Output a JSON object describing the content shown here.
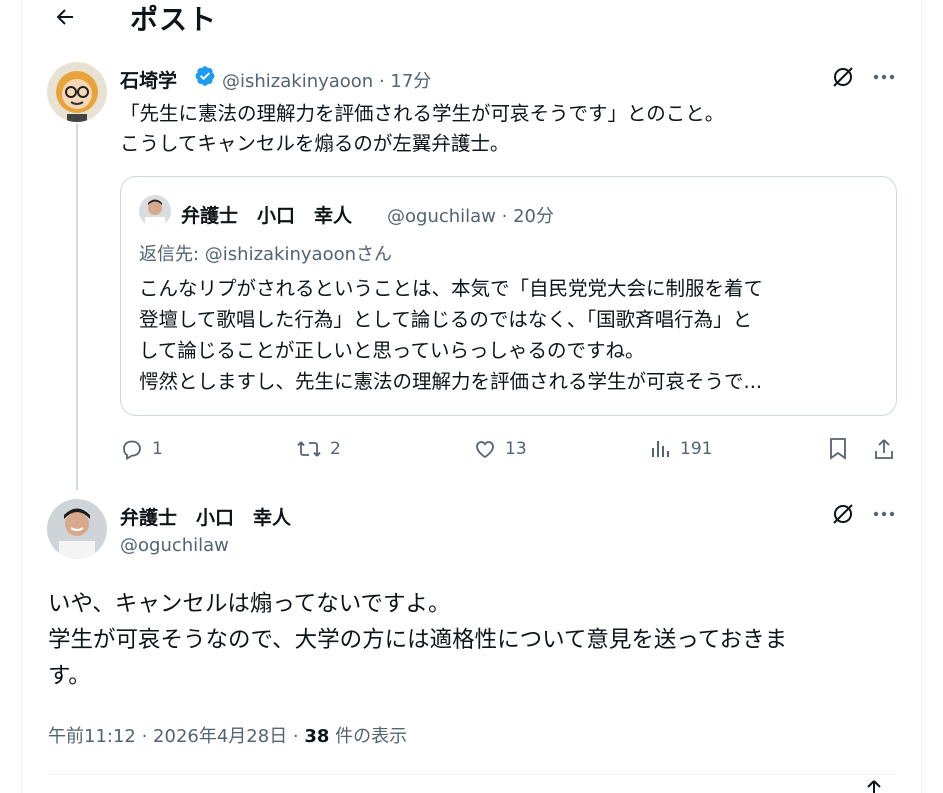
{
  "header": {
    "title": "ポスト"
  },
  "tweet1": {
    "name": "石埼学",
    "handle": "@ishizakinyaoon · 17分",
    "lines": [
      "「先生に憲法の理解力を評価される学生が可哀そうです」とのこと。",
      "こうしてキャンセルを煽るのが左翼弁護士。"
    ]
  },
  "quote": {
    "name": "弁護士　小口　幸人",
    "handle": "@oguchilaw · 20分",
    "reply_to": "返信先: @ishizakinyaoonさん",
    "lines": [
      "こんなリプがされるということは、本気で「自民党党大会に制服を着て",
      "登壇して歌唱した行為」として論じるのではなく、「国歌斉唱行為」と",
      "して論じることが正しいと思っていらっしゃるのですね。",
      "愕然としますし、先生に憲法の理解力を評価される学生が可哀そうで..."
    ]
  },
  "actions": {
    "replies": "1",
    "reposts": "2",
    "likes": "13",
    "views": "191"
  },
  "tweet2": {
    "name": "弁護士　小口　幸人",
    "handle": "@oguchilaw",
    "lines": [
      "いや、キャンセルは煽ってないですよ。",
      "学生が可哀そうなので、大学の方には適格性について意見を送っておきま",
      "す。"
    ],
    "meta_time": "午前11:12 · 2026年4月28日 · ",
    "meta_views": "38",
    "meta_suffix": " 件の表示"
  },
  "colors": {
    "verified": "#1d9bf0",
    "secondary_text": "#536471",
    "border": "#cfd9de"
  },
  "icons": [
    "back-arrow-icon",
    "verified-badge-icon",
    "grok-icon",
    "more-icon",
    "reply-icon",
    "repost-icon",
    "like-icon",
    "views-icon",
    "bookmark-icon",
    "share-icon"
  ]
}
